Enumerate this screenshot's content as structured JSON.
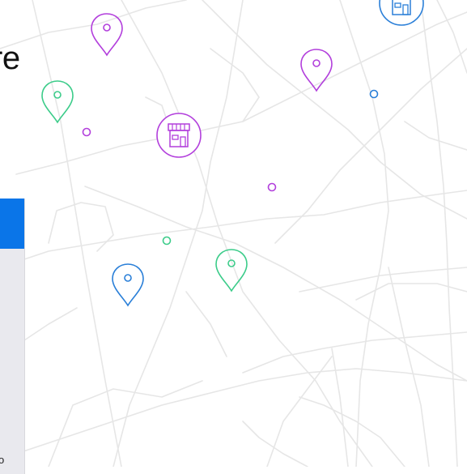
{
  "heading": {
    "visible_text": "re"
  },
  "side_panel": {
    "bottom_text": "o"
  },
  "colors": {
    "road": "#e6e6e6",
    "purple": "#b23fdc",
    "green": "#3ccc8a",
    "blue": "#2a7fd8",
    "panel_header": "#0a75e8",
    "panel_bg": "#e9e9ee"
  },
  "markers": [
    {
      "id": "pin-purple-1",
      "kind": "pin",
      "color": "purple"
    },
    {
      "id": "pin-green-1",
      "kind": "pin",
      "color": "green"
    },
    {
      "id": "dot-purple-1",
      "kind": "dot",
      "color": "purple"
    },
    {
      "id": "store-purple-1",
      "kind": "store",
      "color": "purple"
    },
    {
      "id": "pin-purple-2",
      "kind": "pin",
      "color": "purple"
    },
    {
      "id": "dot-blue-1",
      "kind": "dot",
      "color": "blue"
    },
    {
      "id": "store-blue-1",
      "kind": "store",
      "color": "blue"
    },
    {
      "id": "dot-purple-2",
      "kind": "dot",
      "color": "purple"
    },
    {
      "id": "dot-green-1",
      "kind": "dot",
      "color": "green"
    },
    {
      "id": "pin-green-2",
      "kind": "pin",
      "color": "green"
    },
    {
      "id": "pin-blue-1",
      "kind": "pin",
      "color": "blue"
    }
  ]
}
